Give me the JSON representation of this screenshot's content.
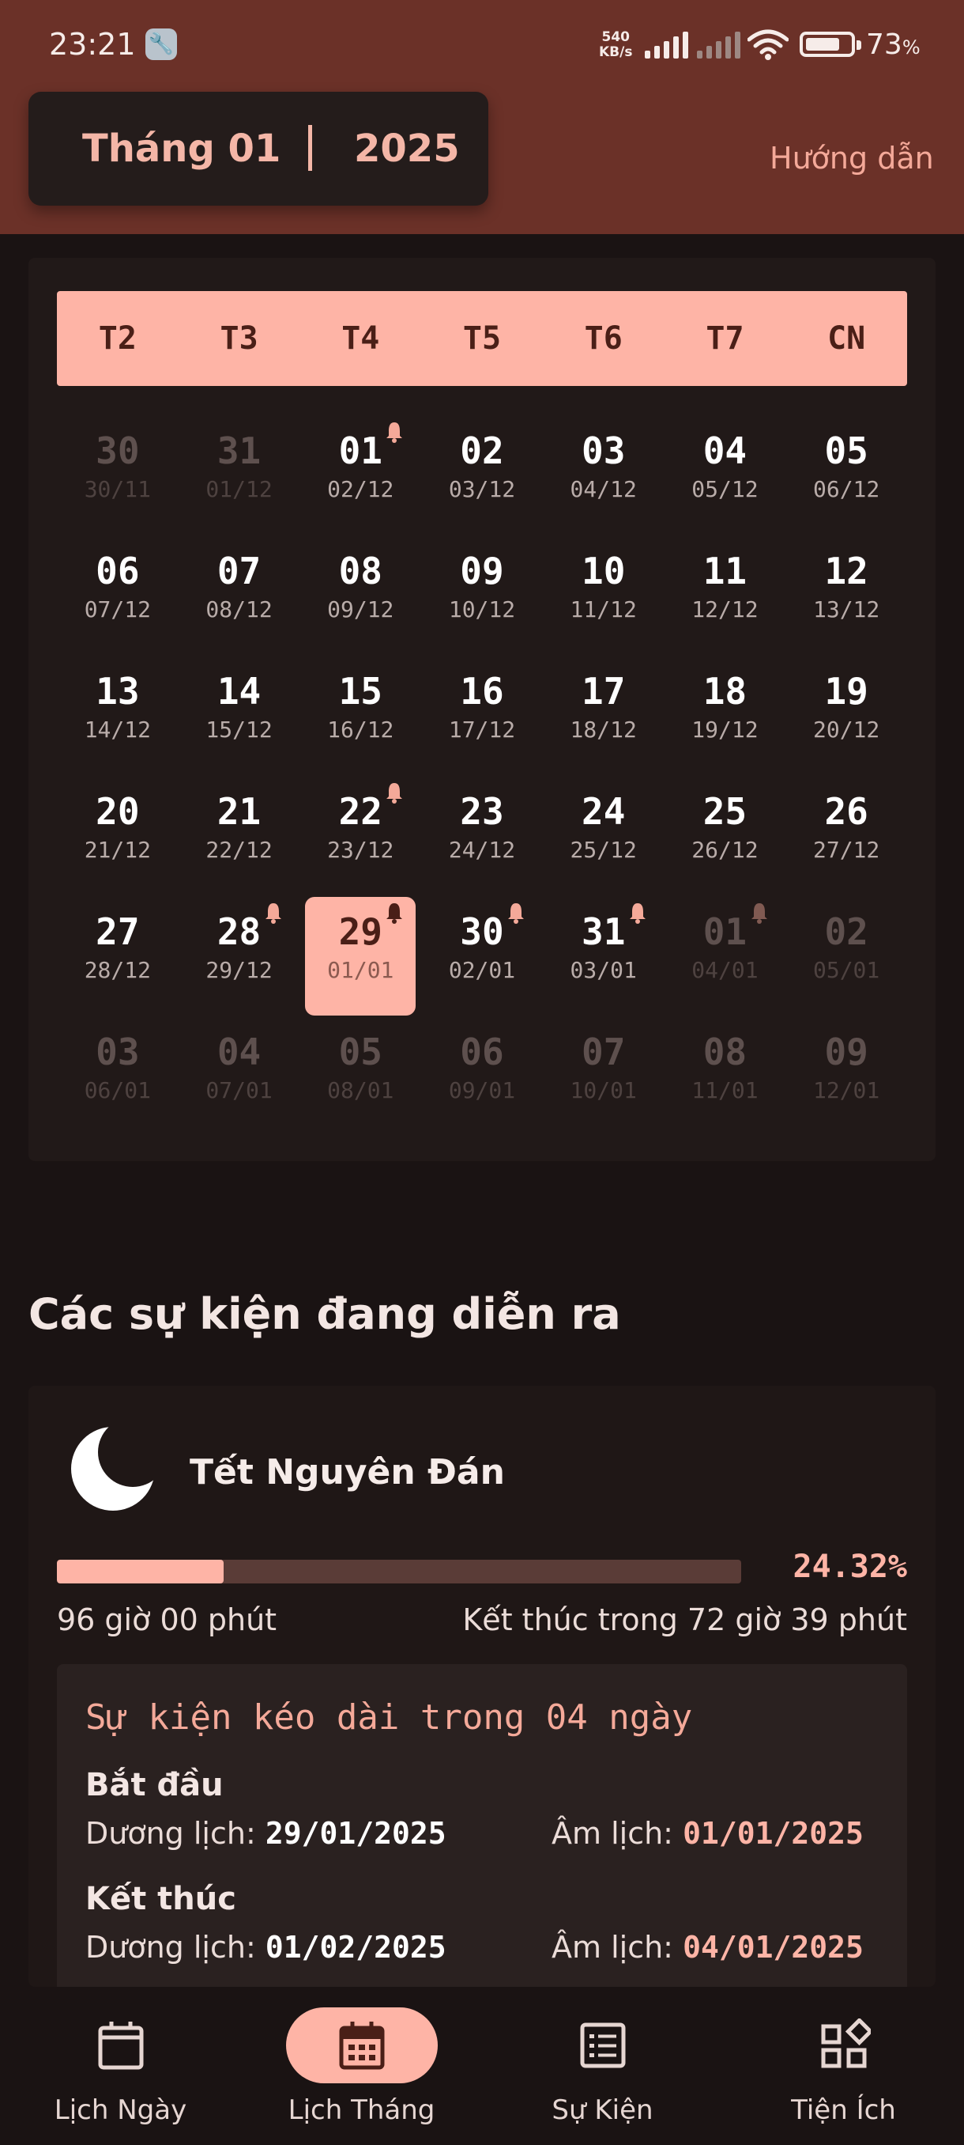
{
  "status_bar": {
    "time": "23:21",
    "net_speed_value": "540",
    "net_speed_unit": "KB/s",
    "battery_percent": "73",
    "battery_unit": "%"
  },
  "header": {
    "month_label": "Tháng 01",
    "year_label": "2025",
    "guide_link": "Hướng dẫn"
  },
  "calendar": {
    "weekdays": [
      "T2",
      "T3",
      "T4",
      "T5",
      "T6",
      "T7",
      "CN"
    ],
    "weeks": [
      [
        {
          "day": "30",
          "lunar": "30/11",
          "other": true
        },
        {
          "day": "31",
          "lunar": "01/12",
          "other": true
        },
        {
          "day": "01",
          "lunar": "02/12",
          "bell": true
        },
        {
          "day": "02",
          "lunar": "03/12"
        },
        {
          "day": "03",
          "lunar": "04/12"
        },
        {
          "day": "04",
          "lunar": "05/12"
        },
        {
          "day": "05",
          "lunar": "06/12"
        }
      ],
      [
        {
          "day": "06",
          "lunar": "07/12"
        },
        {
          "day": "07",
          "lunar": "08/12"
        },
        {
          "day": "08",
          "lunar": "09/12"
        },
        {
          "day": "09",
          "lunar": "10/12"
        },
        {
          "day": "10",
          "lunar": "11/12"
        },
        {
          "day": "11",
          "lunar": "12/12"
        },
        {
          "day": "12",
          "lunar": "13/12"
        }
      ],
      [
        {
          "day": "13",
          "lunar": "14/12"
        },
        {
          "day": "14",
          "lunar": "15/12"
        },
        {
          "day": "15",
          "lunar": "16/12"
        },
        {
          "day": "16",
          "lunar": "17/12"
        },
        {
          "day": "17",
          "lunar": "18/12"
        },
        {
          "day": "18",
          "lunar": "19/12"
        },
        {
          "day": "19",
          "lunar": "20/12"
        }
      ],
      [
        {
          "day": "20",
          "lunar": "21/12"
        },
        {
          "day": "21",
          "lunar": "22/12"
        },
        {
          "day": "22",
          "lunar": "23/12",
          "bell": true
        },
        {
          "day": "23",
          "lunar": "24/12"
        },
        {
          "day": "24",
          "lunar": "25/12"
        },
        {
          "day": "25",
          "lunar": "26/12"
        },
        {
          "day": "26",
          "lunar": "27/12"
        }
      ],
      [
        {
          "day": "27",
          "lunar": "28/12"
        },
        {
          "day": "28",
          "lunar": "29/12",
          "bell": true
        },
        {
          "day": "29",
          "lunar": "01/01",
          "bell": true,
          "selected": true
        },
        {
          "day": "30",
          "lunar": "02/01",
          "bell": true
        },
        {
          "day": "31",
          "lunar": "03/01",
          "bell": true
        },
        {
          "day": "01",
          "lunar": "04/01",
          "other": true,
          "bell": true
        },
        {
          "day": "02",
          "lunar": "05/01",
          "other": true
        }
      ],
      [
        {
          "day": "03",
          "lunar": "06/01",
          "other": true
        },
        {
          "day": "04",
          "lunar": "07/01",
          "other": true
        },
        {
          "day": "05",
          "lunar": "08/01",
          "other": true
        },
        {
          "day": "06",
          "lunar": "09/01",
          "other": true
        },
        {
          "day": "07",
          "lunar": "10/01",
          "other": true
        },
        {
          "day": "08",
          "lunar": "11/01",
          "other": true
        },
        {
          "day": "09",
          "lunar": "12/01",
          "other": true
        }
      ]
    ]
  },
  "events": {
    "section_title": "Các sự kiện đang diễn ra",
    "event": {
      "icon": "moon-icon",
      "name": "Tết Nguyên Đán",
      "progress_fraction": 0.2432,
      "progress_text": "24.32%",
      "elapsed": "96 giờ 00 phút",
      "remaining": "Kết thúc trong 72 giờ 39 phút",
      "duration": "Sự kiện kéo dài trong 04 ngày",
      "start_label": "Bắt đầu",
      "end_label": "Kết thúc",
      "solar_prefix": "Dương lịch:",
      "lunar_prefix": "Âm lịch:",
      "start_solar": "29/01/2025",
      "start_lunar": "01/01/2025",
      "end_solar": "01/02/2025",
      "end_lunar": "04/01/2025"
    }
  },
  "nav": {
    "items": [
      {
        "label": "Lịch Ngày",
        "icon": "calendar-day-icon"
      },
      {
        "label": "Lịch Tháng",
        "icon": "calendar-month-icon",
        "active": true
      },
      {
        "label": "Sự Kiện",
        "icon": "list-icon"
      },
      {
        "label": "Tiện Ích",
        "icon": "widgets-icon"
      }
    ]
  },
  "colors": {
    "header_bg": "#6b3128",
    "accent": "#feb4a6",
    "background": "#1a1313"
  }
}
